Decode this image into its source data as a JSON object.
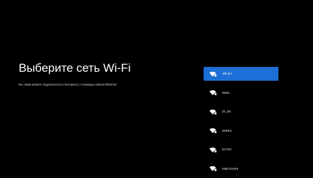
{
  "left_panel": {
    "title": "Выберите сеть Wi-Fi",
    "subtitle": "Вы также можете подключиться к Интернету с помощью кабеля Ethernet"
  },
  "networks": [
    {
      "label": "wifi.pro",
      "selected": true,
      "icon": "wifi-lock-icon"
    },
    {
      "label": "NIKE",
      "selected": false,
      "icon": "wifi-lock-icon"
    },
    {
      "label": "DI_58",
      "selected": false,
      "icon": "wifi-lock-icon"
    },
    {
      "label": "DIREC",
      "selected": false,
      "icon": "wifi-lock-icon"
    },
    {
      "label": "EXT67",
      "selected": false,
      "icon": "wifi-lock-icon"
    },
    {
      "label": "MainCentre",
      "selected": false,
      "icon": "wifi-lock-icon"
    }
  ],
  "colors": {
    "background": "#000000",
    "selection": "#1d6fd6",
    "text": "#ffffff"
  }
}
